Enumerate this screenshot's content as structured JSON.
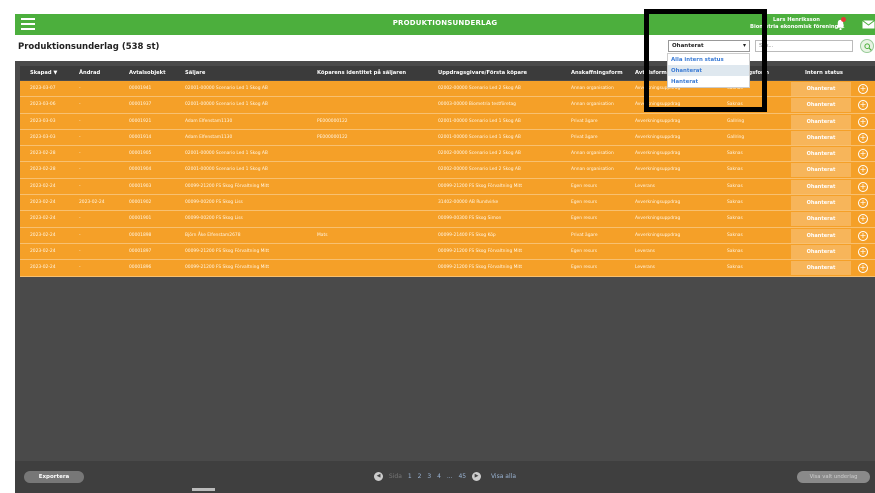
{
  "topbar": {
    "title": "PRODUKTIONSUNDERLAG",
    "user_name": "Lars Henriksson",
    "user_org": "Biometria ekonomisk förening ▼"
  },
  "header": {
    "page_title": "Produktionsunderlag (538 st)",
    "status_value": "Ohanterat",
    "search_placeholder": "Sök..."
  },
  "dropdown": {
    "options": [
      "Alla intern status",
      "Ohanterat",
      "Hanterat"
    ]
  },
  "table": {
    "columns": [
      "Skapad ▼",
      "Ändrad",
      "Avtalsobjekt",
      "Säljare",
      "Köparens identitet på säljaren",
      "Uppdragsgivare/Första köpare",
      "Anskaffningsform",
      "Avtalsform",
      "Uppdragsform",
      "Intern status"
    ],
    "rows": [
      [
        "2023-03-07",
        "-",
        "00001941",
        "02001-00000 Scenario Led 1 Skog AB",
        "",
        "02002-00000 Scenario Led 2 Skog AB",
        "Annan organisation",
        "Avverkningsuppdrag",
        "Saknas",
        "Ohanterat"
      ],
      [
        "2023-03-06",
        "-",
        "00001937",
        "02001-00000 Scenario Led 1 Skog AB",
        "",
        "00003-00000 Biometria testföretag",
        "Annan organisation",
        "Avverkningsuppdrag",
        "Saknas",
        "Ohanterat"
      ],
      [
        "2023-03-03",
        "-",
        "00001921",
        "Adam Elfenstam1130",
        "PE000000122",
        "02001-00000 Scenario Led 1 Skog AB",
        "Privat ägare",
        "Avverkningsuppdrag",
        "Gallring",
        "Ohanterat"
      ],
      [
        "2023-03-03",
        "-",
        "00001914",
        "Adam Elfenstam1130",
        "PE000000122",
        "02001-00000 Scenario Led 1 Skog AB",
        "Privat ägare",
        "Avverkningsuppdrag",
        "Gallring",
        "Ohanterat"
      ],
      [
        "2023-02-28",
        "-",
        "00001905",
        "02001-00000 Scenario Led 1 Skog AB",
        "",
        "02002-00000 Scenario Led 2 Skog AB",
        "Annan organisation",
        "Avverkningsuppdrag",
        "Saknas",
        "Ohanterat"
      ],
      [
        "2023-02-28",
        "-",
        "00001904",
        "02001-00000 Scenario Led 1 Skog AB",
        "",
        "02002-00000 Scenario Led 2 Skog AB",
        "Annan organisation",
        "Avverkningsuppdrag",
        "Saknas",
        "Ohanterat"
      ],
      [
        "2023-02-24",
        "-",
        "00001903",
        "00099-21200 FS Skog Förvaltning Mitt",
        "",
        "00099-21200 FS Skog Förvaltning Mitt",
        "Egen resurs",
        "Leverans",
        "Saknas",
        "Ohanterat"
      ],
      [
        "2023-02-24",
        "2023-02-24",
        "00001902",
        "00099-00200 FS Skog Liss",
        "",
        "31402-00000 AB Rundvirke",
        "Egen resurs",
        "Avverkningsuppdrag",
        "Saknas",
        "Ohanterat"
      ],
      [
        "2023-02-24",
        "-",
        "00001901",
        "00099-00200 FS Skog Liss",
        "",
        "00099-00300 FS Skog Simon",
        "Egen resurs",
        "Avverkningsuppdrag",
        "Saknas",
        "Ohanterat"
      ],
      [
        "2023-02-24",
        "-",
        "00001898",
        "Björn Åke Elfenstam2678",
        "Mats",
        "00099-21400 FS Skog Köp",
        "Privat ägare",
        "Avverkningsuppdrag",
        "Saknas",
        "Ohanterat"
      ],
      [
        "2023-02-24",
        "-",
        "00001897",
        "00099-21200 FS Skog Förvaltning Mitt",
        "",
        "00099-21200 FS Skog Förvaltning Mitt",
        "Egen resurs",
        "Leverans",
        "Saknas",
        "Ohanterat"
      ],
      [
        "2023-02-24",
        "-",
        "00001896",
        "00099-21200 FS Skog Förvaltning Mitt",
        "",
        "00099-21200 FS Skog Förvaltning Mitt",
        "Egen resurs",
        "Leverans",
        "Saknas",
        "Ohanterat"
      ]
    ]
  },
  "footer": {
    "export_label": "Exportera",
    "page_word": "Sida",
    "pages": [
      "1",
      "2",
      "3",
      "4",
      "...",
      "45"
    ],
    "show_all": "Visa alla",
    "show_selected": "Visa valt underlag"
  },
  "colors": {
    "brand_green": "#4caf3d",
    "row_orange": "#f5a028",
    "grid_dark": "#4a4a4a"
  }
}
